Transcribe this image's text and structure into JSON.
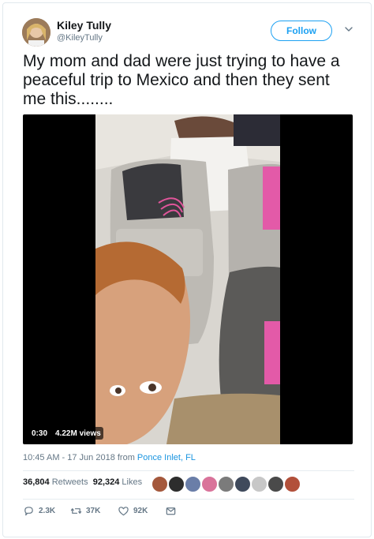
{
  "user": {
    "name": "Kiley Tully",
    "handle": "@KileyTully"
  },
  "follow_label": "Follow",
  "tweet": {
    "text": "My mom and dad were just trying to have a peaceful trip to Mexico and then they sent me this........"
  },
  "video": {
    "duration": "0:30",
    "views": "4.22M views"
  },
  "meta": {
    "time": "10:45 AM - 17 Jun 2018 from ",
    "location": "Ponce Inlet, FL"
  },
  "stats": {
    "retweets_count": "36,804",
    "retweets_label": "Retweets",
    "likes_count": "92,324",
    "likes_label": "Likes"
  },
  "actions": {
    "reply": "2.3K",
    "retweet": "37K",
    "like": "92K"
  },
  "colors": {
    "brand": "#1da1f2",
    "link": "#1b95e0",
    "muted": "#657786"
  },
  "icons": [
    "chevron-down-icon",
    "reply-icon",
    "retweet-icon",
    "heart-icon",
    "message-icon"
  ]
}
